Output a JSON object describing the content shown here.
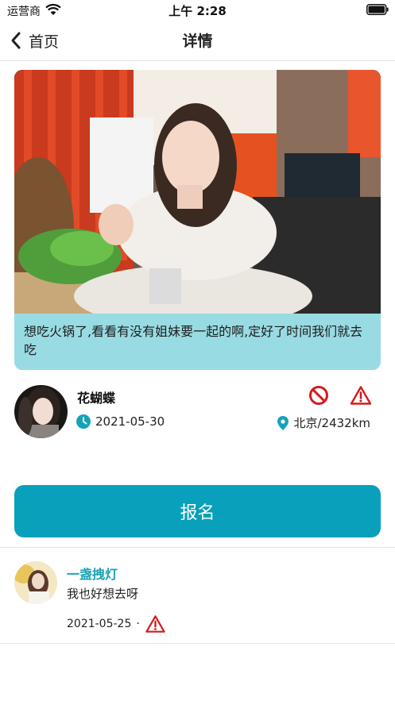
{
  "status_bar": {
    "carrier": "运营商",
    "time": "上午 2:28"
  },
  "nav": {
    "back_label": "首页",
    "title": "详情"
  },
  "post": {
    "photo": "woman-at-hotpot-restaurant-photo",
    "text": "想吃火锅了,看看有没有姐妹要一起的啊,定好了时间我们就去吃",
    "card_color": "#99dbe3"
  },
  "author": {
    "name": "花蝴蝶",
    "date": "2021-05-30",
    "location": "北京/2432km"
  },
  "actions": {
    "signup_label": "报名",
    "signup_color": "#08a0ba",
    "alert_color": "#d21d1d"
  },
  "comments": [
    {
      "author": "一盏拽灯",
      "text": "我也好想去呀",
      "date": "2021-05-25",
      "separator": "·"
    }
  ]
}
